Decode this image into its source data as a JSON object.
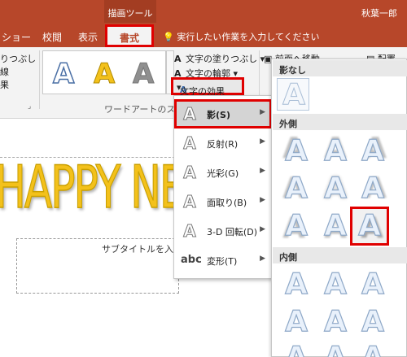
{
  "ribbon_tabs": {
    "context_label": "描画ツール",
    "user_name": "秋葉一郎",
    "tab_slideshow": "ショー",
    "tab_review": "校閲",
    "tab_view": "表示",
    "tab_format": "書式",
    "tell_me": "実行したい作業を入力してください"
  },
  "ribbon": {
    "shape_fill_partial": "りつぶし",
    "shape_outline_partial": "線",
    "shape_effects_partial": "果",
    "wordart_group_label": "ワードアートのスタイル",
    "text_fill_label": "文字の塗りつぶし",
    "text_outline_label": "文字の輪郭",
    "text_effects_label": "文字の効果",
    "bring_forward_label": "前面へ移動",
    "align_label": "配置",
    "wordart_samples": [
      "A",
      "A",
      "A"
    ]
  },
  "slide": {
    "title_text": "HAPPY NEW",
    "subtitle_placeholder": "サブタイトルを入"
  },
  "effects_menu": {
    "items": [
      {
        "label": "影(S)",
        "icon": "A",
        "active": true
      },
      {
        "label": "反射(R)",
        "icon": "A",
        "active": false
      },
      {
        "label": "光彩(G)",
        "icon": "A",
        "active": false
      },
      {
        "label": "面取り(B)",
        "icon": "A",
        "active": false
      },
      {
        "label": "3-D 回転(D)",
        "icon": "A",
        "active": false
      },
      {
        "label": "変形(T)",
        "icon": "abc",
        "active": false
      }
    ]
  },
  "shadow_panel": {
    "section_none": "影なし",
    "section_outer": "外側",
    "section_inner": "内側",
    "sample_letter": "A",
    "selected_preset": "outer-row3-col3"
  },
  "colors": {
    "brand": "#b7472a",
    "highlight": "#e00000",
    "wordart_gold": "#f3c11b"
  }
}
